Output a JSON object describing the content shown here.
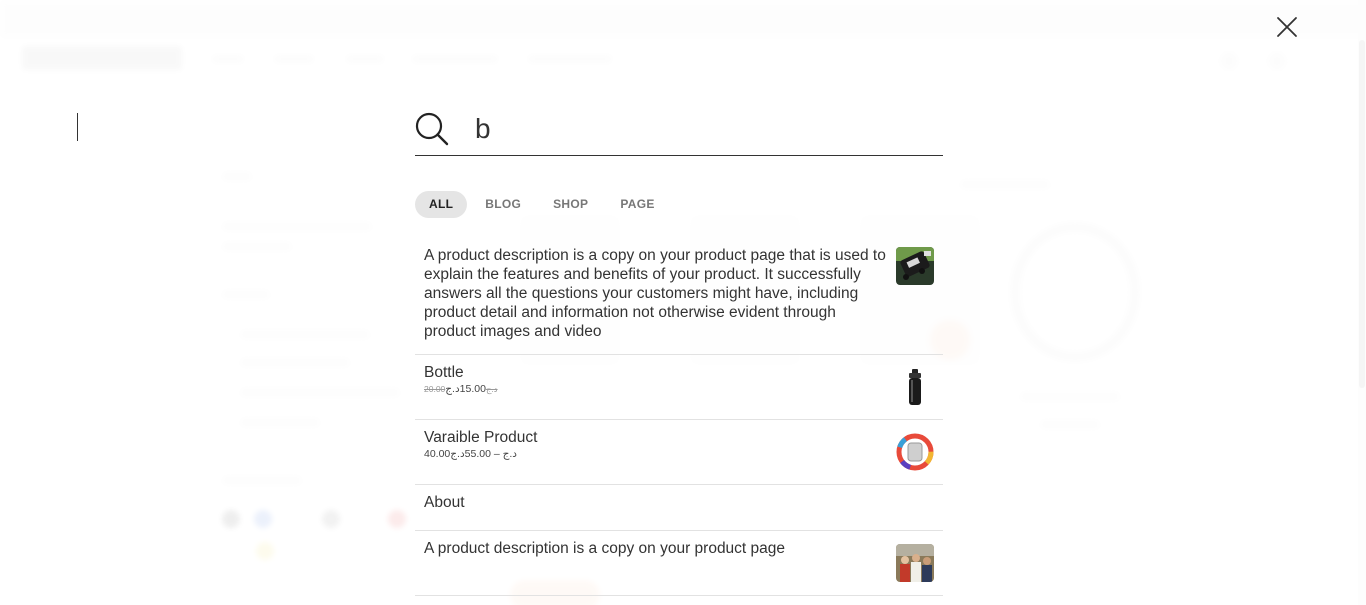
{
  "search": {
    "query": "b",
    "placeholder": ""
  },
  "tabs": [
    {
      "label": "ALL",
      "active": true
    },
    {
      "label": "BLOG",
      "active": false
    },
    {
      "label": "SHOP",
      "active": false
    },
    {
      "label": "PAGE",
      "active": false
    }
  ],
  "results": [
    {
      "title": "A product description is a copy on your product page that is used to explain the features and benefits of your product. It successfully answers all the questions your customers might have, including product detail and information not otherwise evident through product images and video",
      "thumb": "rolling-luggage-thumbnail"
    },
    {
      "title": "Bottle",
      "price_old": "20.00د.ج",
      "price": "15.00د.ج",
      "thumb": "black-bottle-thumbnail"
    },
    {
      "title": "Varaible Product",
      "price": "40.00د.ج – 55.00د.ج",
      "thumb": "watch-band-thumbnail"
    },
    {
      "title": "About"
    },
    {
      "title": "A product description is a copy on your product page",
      "thumb": "people-photo-thumbnail"
    }
  ],
  "icons": {
    "close": "close-icon",
    "search": "search-icon"
  },
  "colors": {
    "text": "#333333",
    "active_tab_bg": "#e5e5e5",
    "divider": "#e2e2e2"
  }
}
